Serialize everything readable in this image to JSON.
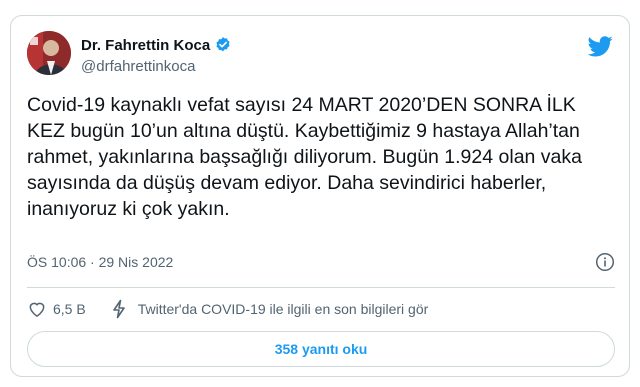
{
  "author": {
    "name": "Dr. Fahrettin Koca",
    "handle": "@drfahrettinkoca"
  },
  "icons": {
    "avatar": "profile-photo",
    "verified": "verified-badge-icon",
    "brand": "twitter-bird-icon",
    "info": "info-circle-icon",
    "like": "heart-icon",
    "covid_link": "lightning-bolt-icon"
  },
  "tweet": {
    "text": "Covid-19 kaynaklı vefat sayısı 24 MART 2020’DEN SONRA İLK KEZ bugün 10’un altına düştü. Kaybettiğimiz 9 hastaya Allah’tan rahmet, yakınlarına başsağlığı diliyorum. Bugün 1.924 olan vaka sayısında da düşüş devam ediyor. Daha sevindirici haberler, inanıyoruz ki çok yakın.",
    "timestamp": "ÖS 10:06 · 29 Nis 2022"
  },
  "actions": {
    "likes": "6,5 B",
    "covid_info": "Twitter'da COVID-19 ile ilgili en son bilgileri gör"
  },
  "replies_button": "358 yanıtı oku",
  "colors": {
    "brand_blue": "#1d9bf0",
    "text": "#0f1419",
    "muted": "#536471",
    "border": "#cfd9de"
  }
}
